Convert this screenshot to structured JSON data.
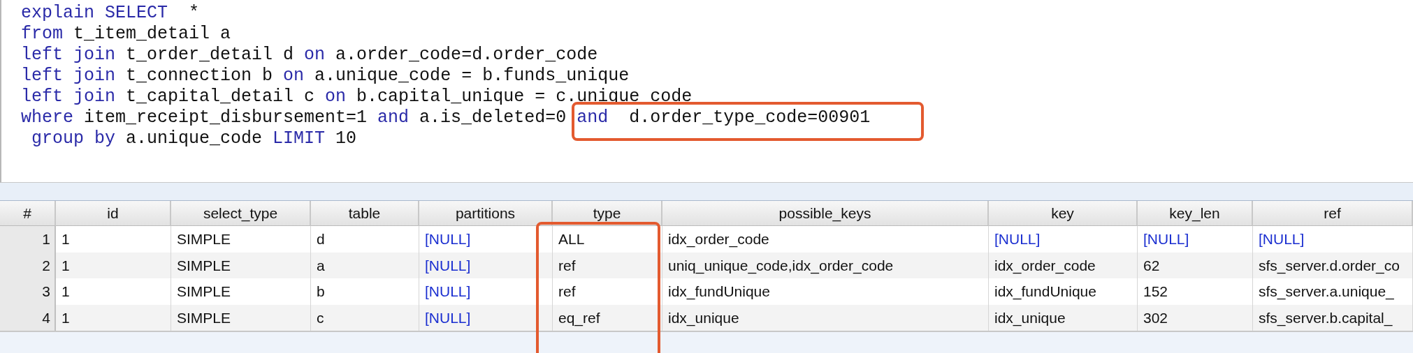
{
  "editor": {
    "lines": [
      [
        {
          "kind": "keyword",
          "text": "explain SELECT"
        },
        {
          "kind": "plain",
          "text": "  *"
        }
      ],
      [
        {
          "kind": "keyword",
          "text": "from"
        },
        {
          "kind": "plain",
          "text": " t_item_detail a"
        }
      ],
      [
        {
          "kind": "keyword",
          "text": "left join"
        },
        {
          "kind": "plain",
          "text": " t_order_detail d "
        },
        {
          "kind": "keyword",
          "text": "on"
        },
        {
          "kind": "plain",
          "text": " a.order_code=d.order_code"
        }
      ],
      [
        {
          "kind": "keyword",
          "text": "left join"
        },
        {
          "kind": "plain",
          "text": " t_connection b "
        },
        {
          "kind": "keyword",
          "text": "on"
        },
        {
          "kind": "plain",
          "text": " a.unique_code = b.funds_unique"
        }
      ],
      [
        {
          "kind": "keyword",
          "text": "left join"
        },
        {
          "kind": "plain",
          "text": " t_capital_detail c "
        },
        {
          "kind": "keyword",
          "text": "on"
        },
        {
          "kind": "plain",
          "text": " b.capital_unique = c.unique_code"
        }
      ],
      [
        {
          "kind": "keyword",
          "text": "where"
        },
        {
          "kind": "plain",
          "text": " item_receipt_disbursement=1 "
        },
        {
          "kind": "keyword",
          "text": "and"
        },
        {
          "kind": "plain",
          "text": " a.is_deleted=0 "
        },
        {
          "kind": "keyword",
          "text": "and"
        },
        {
          "kind": "plain",
          "text": "  d.order_type_code=00901"
        }
      ],
      [
        {
          "kind": "keyword",
          "text": " group by"
        },
        {
          "kind": "plain",
          "text": " a.unique_code "
        },
        {
          "kind": "keyword",
          "text": "LIMIT"
        },
        {
          "kind": "plain",
          "text": " 10"
        }
      ]
    ]
  },
  "annotations": [
    {
      "kind": "highlight-box",
      "color": "#e35a2f"
    },
    {
      "kind": "highlight-box",
      "color": "#e35a2f"
    }
  ],
  "table": {
    "columns": [
      "#",
      "id",
      "select_type",
      "table",
      "partitions",
      "type",
      "possible_keys",
      "key",
      "key_len",
      "ref"
    ],
    "rows": [
      [
        {
          "text": "1",
          "null": false
        },
        {
          "text": "1",
          "null": false
        },
        {
          "text": "SIMPLE",
          "null": false
        },
        {
          "text": "d",
          "null": false
        },
        {
          "text": "[NULL]",
          "null": true
        },
        {
          "text": "ALL",
          "null": false
        },
        {
          "text": "idx_order_code",
          "null": false
        },
        {
          "text": "[NULL]",
          "null": true
        },
        {
          "text": "[NULL]",
          "null": true
        },
        {
          "text": "[NULL]",
          "null": true
        }
      ],
      [
        {
          "text": "2",
          "null": false
        },
        {
          "text": "1",
          "null": false
        },
        {
          "text": "SIMPLE",
          "null": false
        },
        {
          "text": "a",
          "null": false
        },
        {
          "text": "[NULL]",
          "null": true
        },
        {
          "text": "ref",
          "null": false
        },
        {
          "text": "uniq_unique_code,idx_order_code",
          "null": false
        },
        {
          "text": "idx_order_code",
          "null": false
        },
        {
          "text": "62",
          "null": false
        },
        {
          "text": "sfs_server.d.order_co",
          "null": false
        }
      ],
      [
        {
          "text": "3",
          "null": false
        },
        {
          "text": "1",
          "null": false
        },
        {
          "text": "SIMPLE",
          "null": false
        },
        {
          "text": "b",
          "null": false
        },
        {
          "text": "[NULL]",
          "null": true
        },
        {
          "text": "ref",
          "null": false
        },
        {
          "text": "idx_fundUnique",
          "null": false
        },
        {
          "text": "idx_fundUnique",
          "null": false
        },
        {
          "text": "152",
          "null": false
        },
        {
          "text": "sfs_server.a.unique_",
          "null": false
        }
      ],
      [
        {
          "text": "4",
          "null": false
        },
        {
          "text": "1",
          "null": false
        },
        {
          "text": "SIMPLE",
          "null": false
        },
        {
          "text": "c",
          "null": false
        },
        {
          "text": "[NULL]",
          "null": true
        },
        {
          "text": "eq_ref",
          "null": false
        },
        {
          "text": "idx_unique",
          "null": false
        },
        {
          "text": "idx_unique",
          "null": false
        },
        {
          "text": "302",
          "null": false
        },
        {
          "text": "sfs_server.b.capital_",
          "null": false
        }
      ]
    ]
  }
}
